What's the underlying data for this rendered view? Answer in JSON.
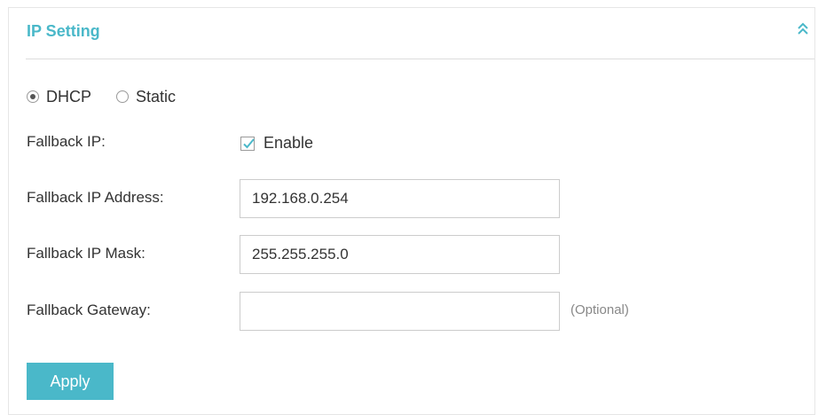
{
  "panel": {
    "title": "IP Setting",
    "collapse_icon": "double-chevron-up-icon",
    "accent_color": "#4ab8c9"
  },
  "ip_mode": {
    "options": [
      {
        "label": "DHCP",
        "selected": true
      },
      {
        "label": "Static",
        "selected": false
      }
    ]
  },
  "fallback_ip": {
    "label": "Fallback IP:",
    "checkbox_label": "Enable",
    "checked": true
  },
  "fallback_ip_address": {
    "label": "Fallback IP Address:",
    "value": "192.168.0.254"
  },
  "fallback_ip_mask": {
    "label": "Fallback IP Mask:",
    "value": "255.255.255.0"
  },
  "fallback_gateway": {
    "label": "Fallback Gateway:",
    "value": "",
    "hint": "(Optional)"
  },
  "apply_button": {
    "label": "Apply"
  }
}
